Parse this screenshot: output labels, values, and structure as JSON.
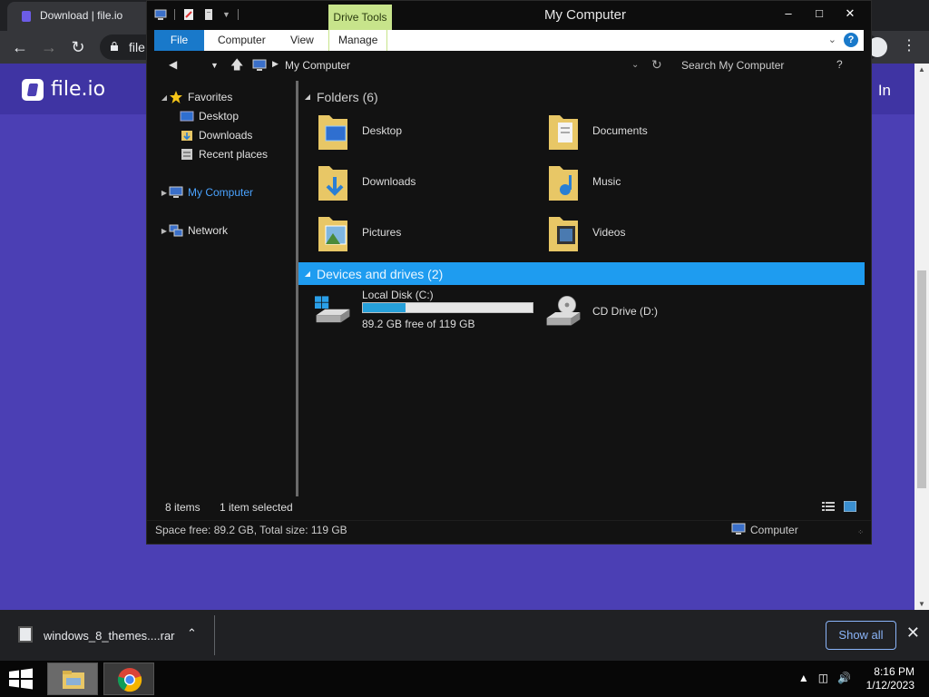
{
  "chrome": {
    "tab_title": "Download | file.io",
    "omnibox_text": "file",
    "site_logo": "file.io",
    "signin_partial": "In",
    "download_file": "windows_8_themes....rar",
    "show_all": "Show all"
  },
  "explorer": {
    "title": "My Computer",
    "drive_tools": "Drive Tools",
    "ribbon_tabs": [
      "File",
      "Computer",
      "View",
      "Manage"
    ],
    "breadcrumb": "My Computer",
    "search_placeholder": "Search My Computer",
    "help_label": "?",
    "nav": {
      "favorites": "Favorites",
      "desktop": "Desktop",
      "downloads": "Downloads",
      "recent": "Recent places",
      "my_computer": "My Computer",
      "network": "Network"
    },
    "folders_header": "Folders (6)",
    "folders": [
      "Desktop",
      "Documents",
      "Downloads",
      "Music",
      "Pictures",
      "Videos"
    ],
    "devices_header": "Devices and drives (2)",
    "drive_c": {
      "label": "Local Disk (C:)",
      "free_text": "89.2 GB free of 119 GB",
      "used_fraction": 0.25
    },
    "drive_d": {
      "label": "CD Drive (D:)"
    },
    "status_items": "8 items",
    "status_selected": "1 item selected",
    "details_space": "Space free: 89.2 GB, Total size: 119 GB",
    "details_location": "Computer"
  },
  "taskbar": {
    "time": "8:16 PM",
    "date": "1/12/2023"
  },
  "colors": {
    "accent_blue": "#1e9cf0",
    "ribbon_file_blue": "#1979ca",
    "drive_tools_green": "#c7e48b",
    "page_purple": "#4b3fb4"
  }
}
